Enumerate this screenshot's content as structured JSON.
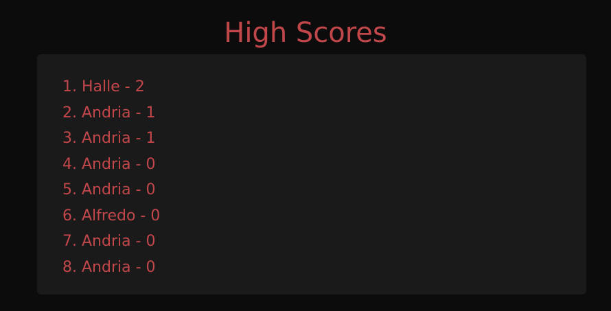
{
  "title": "High Scores",
  "colors": {
    "background": "#0c0c0c",
    "panel": "#1a1a1a",
    "text": "#c2474b"
  },
  "scores": [
    {
      "rank": "1.",
      "name": "Halle",
      "score": "2"
    },
    {
      "rank": "2.",
      "name": "Andria",
      "score": "1"
    },
    {
      "rank": "3.",
      "name": "Andria",
      "score": "1"
    },
    {
      "rank": "4.",
      "name": "Andria",
      "score": "0"
    },
    {
      "rank": "5.",
      "name": "Andria",
      "score": "0"
    },
    {
      "rank": "6.",
      "name": "Alfredo",
      "score": "0"
    },
    {
      "rank": "7.",
      "name": "Andria",
      "score": "0"
    },
    {
      "rank": "8.",
      "name": "Andria",
      "score": "0"
    }
  ]
}
